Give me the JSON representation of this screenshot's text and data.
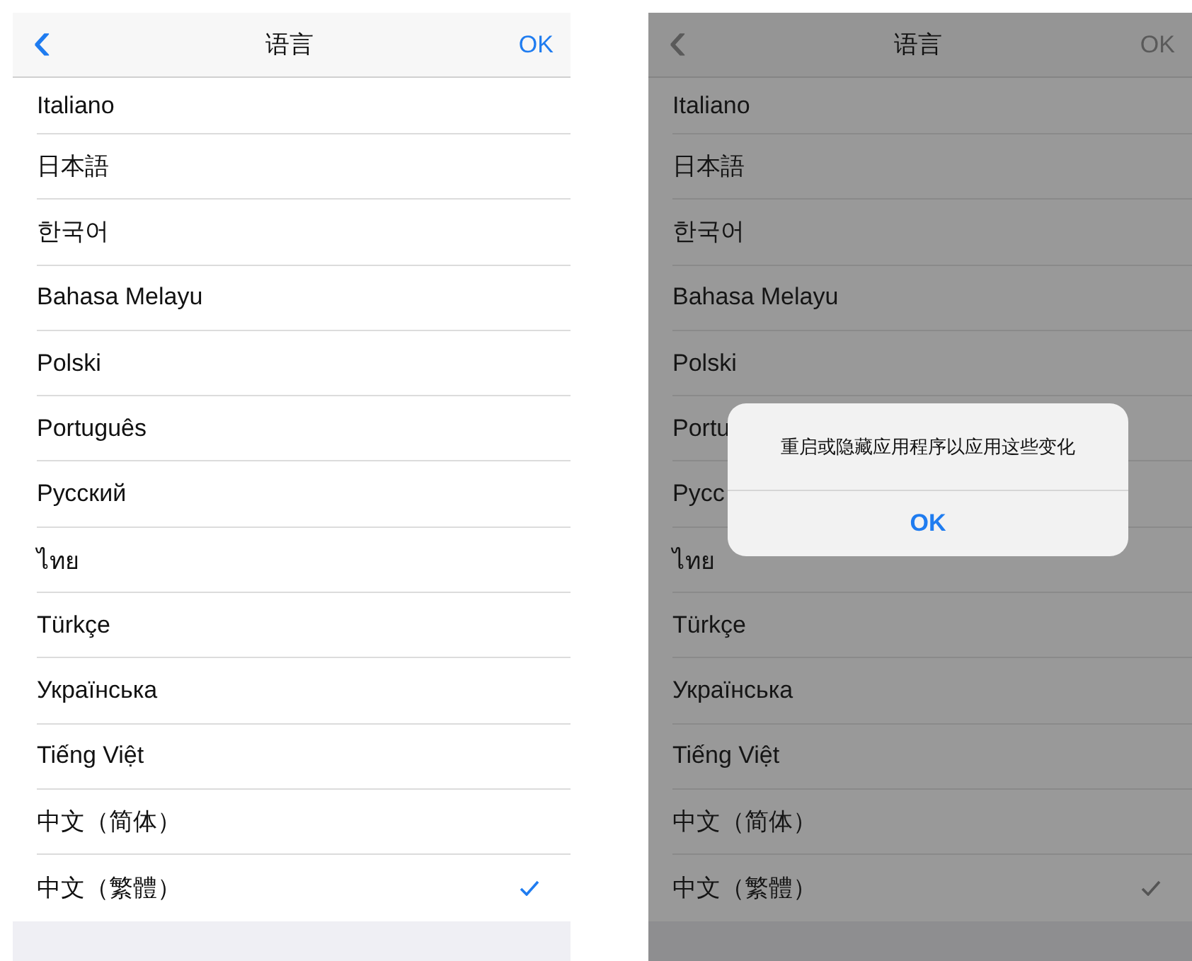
{
  "screens": [
    {
      "dimmed": false,
      "nav": {
        "back": "‹",
        "title": "语言",
        "done": "OK"
      },
      "languages": [
        {
          "label": "Italiano",
          "selected": false
        },
        {
          "label": "日本語",
          "selected": false
        },
        {
          "label": "한국어",
          "selected": false
        },
        {
          "label": "Bahasa Melayu",
          "selected": false
        },
        {
          "label": "Polski",
          "selected": false
        },
        {
          "label": "Português",
          "selected": false
        },
        {
          "label": "Русский",
          "selected": false
        },
        {
          "label": "ไทย",
          "selected": false
        },
        {
          "label": "Türkçe",
          "selected": false
        },
        {
          "label": "Українська",
          "selected": false
        },
        {
          "label": "Tiếng Việt",
          "selected": false
        },
        {
          "label": "中文（简体）",
          "selected": false
        },
        {
          "label": "中文（繁體）",
          "selected": true
        }
      ]
    },
    {
      "dimmed": true,
      "nav": {
        "back": "‹",
        "title": "语言",
        "done": "OK"
      },
      "languages": [
        {
          "label": "Italiano",
          "selected": false
        },
        {
          "label": "日本語",
          "selected": false
        },
        {
          "label": "한국어",
          "selected": false
        },
        {
          "label": "Bahasa Melayu",
          "selected": false
        },
        {
          "label": "Polski",
          "selected": false
        },
        {
          "label": "Portu",
          "selected": false
        },
        {
          "label": "Pycc",
          "selected": false
        },
        {
          "label": "ไทย",
          "selected": false
        },
        {
          "label": "Türkçe",
          "selected": false
        },
        {
          "label": "Українська",
          "selected": false
        },
        {
          "label": "Tiếng Việt",
          "selected": false
        },
        {
          "label": "中文（简体）",
          "selected": false
        },
        {
          "label": "中文（繁體）",
          "selected": true
        }
      ],
      "alert": {
        "message": "重启或隐藏应用程序以应用这些变化",
        "button": "OK"
      }
    }
  ]
}
